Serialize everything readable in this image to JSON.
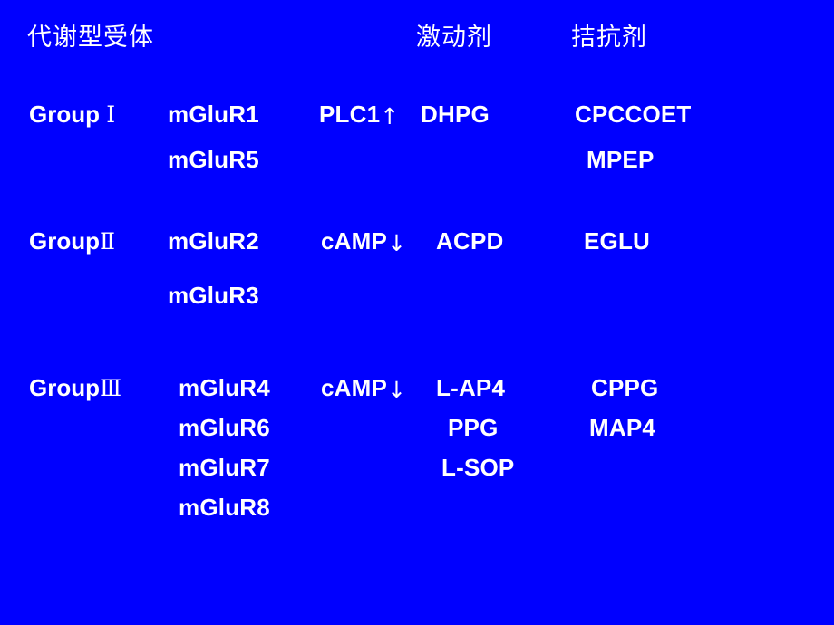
{
  "slide": {
    "background_color": "#0000FF",
    "text_color": "#FFFFFF"
  },
  "header": {
    "receptor_heading": "代谢型受体",
    "agonist_heading": "激动剂",
    "antagonist_heading": "拮抗剂"
  },
  "groups": [
    {
      "group_label": "Group",
      "group_numeral": "Ⅰ",
      "receptors": [
        "mGluR1",
        "mGluR5"
      ],
      "transduction": "PLC1",
      "transduction_arrow": "↑",
      "agonists": [
        "DHPG"
      ],
      "antagonists": [
        "CPCCOET",
        "MPEP"
      ]
    },
    {
      "group_label": "Group",
      "group_numeral": "Ⅱ",
      "receptors": [
        "mGluR2",
        "mGluR3"
      ],
      "transduction": "cAMP",
      "transduction_arrow": "↓",
      "agonists": [
        "ACPD"
      ],
      "antagonists": [
        "EGLU"
      ]
    },
    {
      "group_label": "Group",
      "group_numeral": "Ⅲ",
      "receptors": [
        "mGluR4",
        "mGluR6",
        "mGluR7",
        "mGluR8"
      ],
      "transduction": "cAMP",
      "transduction_arrow": "↓",
      "agonists": [
        "L-AP4",
        "PPG",
        "L-SOP"
      ],
      "antagonists": [
        "CPPG",
        "MAP4"
      ]
    }
  ]
}
